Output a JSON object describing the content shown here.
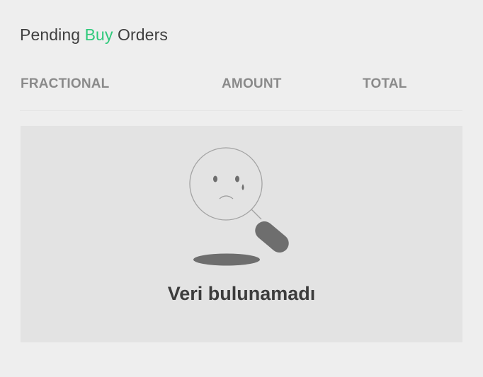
{
  "header": {
    "title_prefix": "Pending ",
    "title_accent": "Buy",
    "title_suffix": " Orders",
    "accent_color": "#2fc97b"
  },
  "table": {
    "columns": [
      "FRACTIONAL",
      "AMOUNT",
      "TOTAL"
    ],
    "rows": []
  },
  "empty_state": {
    "icon": "no-data-magnifier-icon",
    "message": "Veri bulunamadı"
  }
}
